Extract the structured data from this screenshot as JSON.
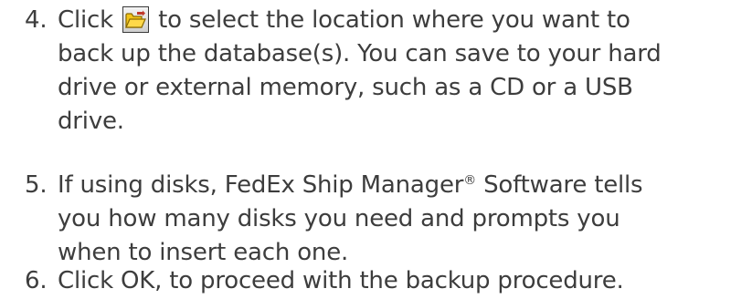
{
  "steps": [
    {
      "number": "4.",
      "text_before_icon": "Click ",
      "icon": "open-folder-icon",
      "lines": [
        " to select the location where you want to",
        "back up the database(s). You can save to your hard",
        "drive or external memory, such as a CD or a USB",
        "drive."
      ]
    },
    {
      "number": "5.",
      "lines": [
        "If using disks, FedEx Ship Manager",
        "®",
        " Software tells",
        "you how many disks you need and prompts you",
        "when to insert each one."
      ]
    },
    {
      "number": "6.",
      "lines": [
        "Click OK, to proceed with the backup procedure."
      ]
    }
  ],
  "colors": {
    "text": "#3d3d3d",
    "folder_fill": "#f2c418",
    "folder_outline": "#8a6a00",
    "arrow": "#c0392b"
  }
}
